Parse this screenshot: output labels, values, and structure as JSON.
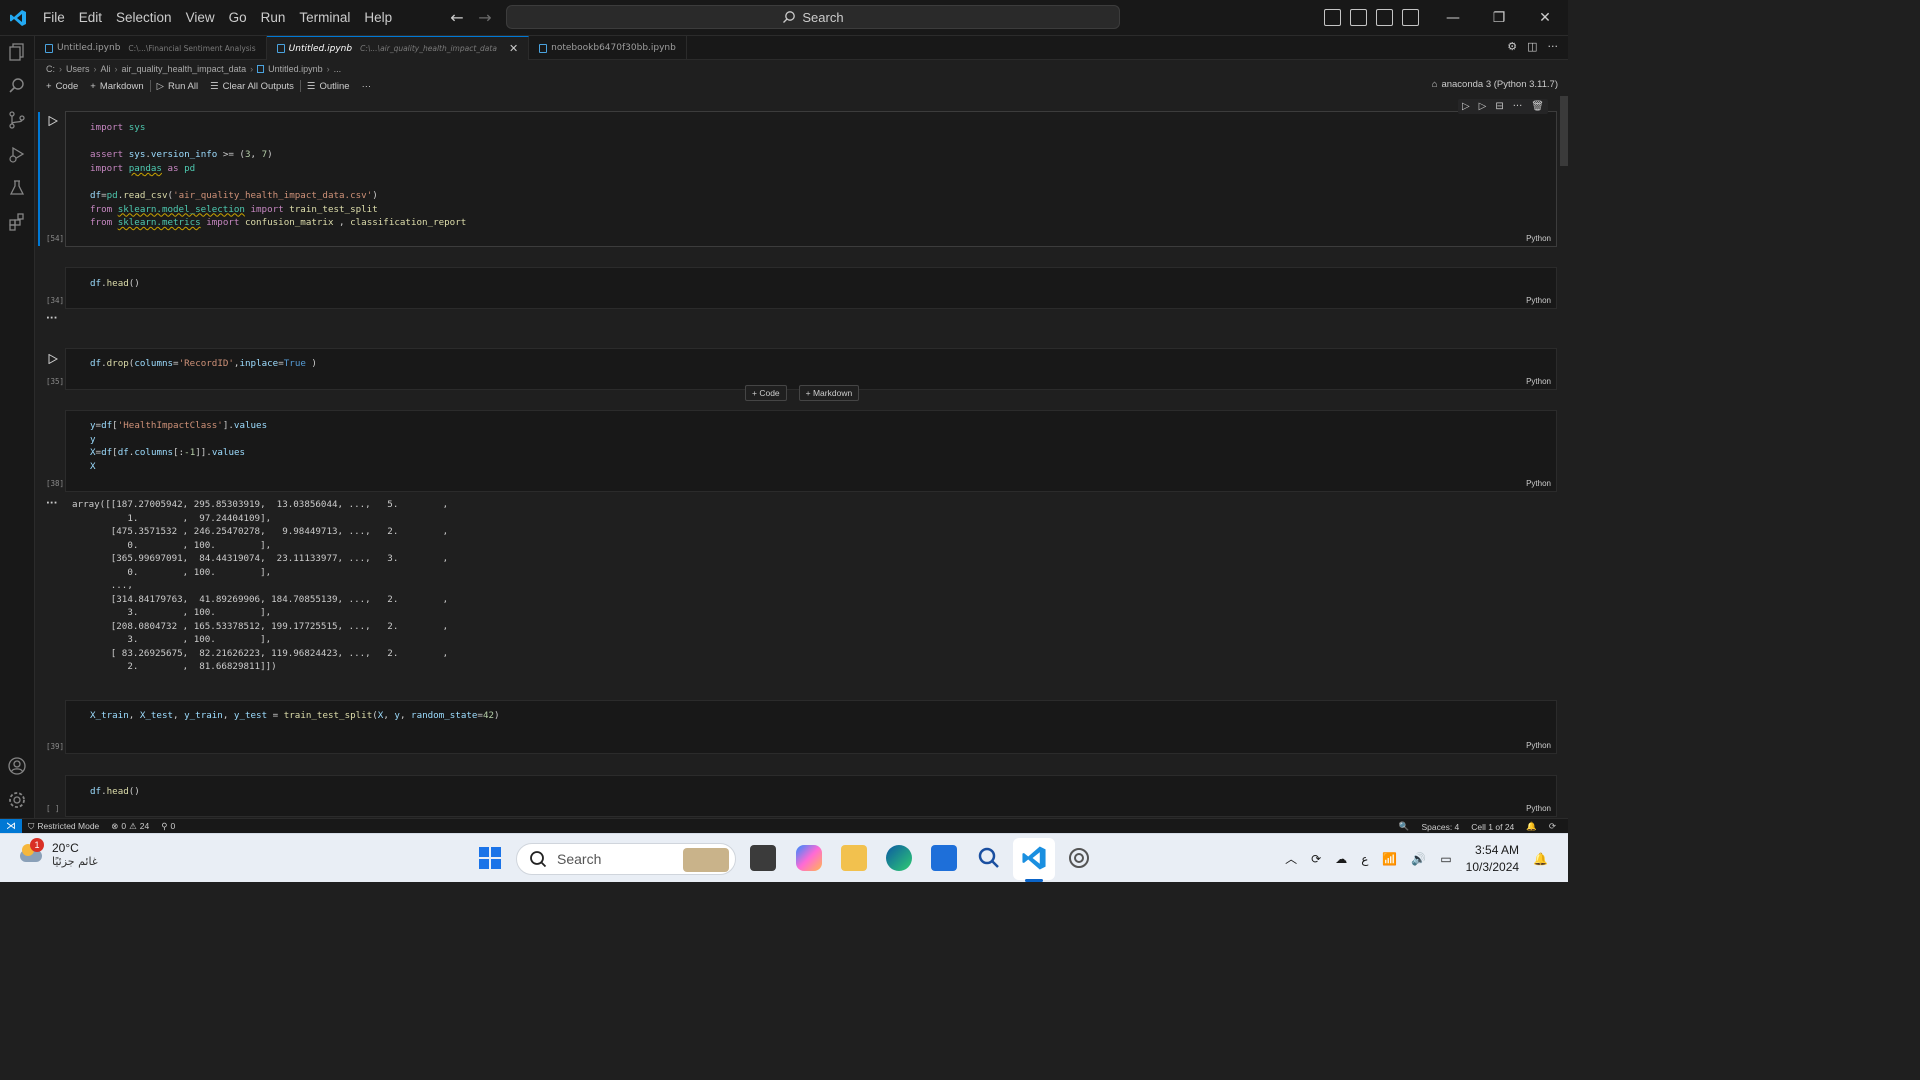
{
  "menu": [
    "File",
    "Edit",
    "Selection",
    "View",
    "Go",
    "Run",
    "Terminal",
    "Help"
  ],
  "search": {
    "label": "Search"
  },
  "tabs": [
    {
      "name": "Untitled.ipynb",
      "path": "C:\\...\\Financial Sentiment Analysis",
      "active": false
    },
    {
      "name": "Untitled.ipynb",
      "path": "C:\\...\\air_quality_health_impact_data",
      "active": true
    },
    {
      "name": "notebookb6470f30bb.ipynb",
      "path": "",
      "active": false
    }
  ],
  "breadcrumb": [
    "C:",
    "Users",
    "Ali",
    "air_quality_health_impact_data",
    "Untitled.ipynb",
    "..."
  ],
  "toolbar": {
    "code": "Code",
    "markdown": "Markdown",
    "run_all": "Run All",
    "clear_outputs": "Clear All Outputs",
    "outline": "Outline",
    "more": "···"
  },
  "kernel": "anaconda 3 (Python 3.11.7)",
  "cells": [
    {
      "exec": "[54]",
      "lang": "Python"
    },
    {
      "exec": "[34]",
      "lang": "Python"
    },
    {
      "exec": "[35]",
      "lang": "Python"
    },
    {
      "exec": "[38]",
      "lang": "Python"
    },
    {
      "exec": "[39]",
      "lang": "Python"
    },
    {
      "exec": "[ ]",
      "lang": "Python"
    }
  ],
  "cell_code": {
    "c1_l1": "import sys",
    "c1_l3": "assert sys.version_info >= (3, 7)",
    "c1_l4": "import pandas as pd",
    "c1_l6": "df=pd.read_csv('air_quality_health_impact_data.csv')",
    "c1_l7": "from sklearn.model_selection import train_test_split",
    "c1_l8": "from sklearn.metrics import confusion_matrix , classification_report",
    "c2": "df.head()",
    "c3": "df.drop(columns='RecordID',inplace=True )",
    "c4_l1": "y=df['HealthImpactClass'].values",
    "c4_l2": "y",
    "c4_l3": "X=df[df.columns[:-1]].values",
    "c4_l4": "X",
    "c5": "X_train, X_test, y_train, y_test = train_test_split(X, y, random_state=42)",
    "c6": "df.head()"
  },
  "output_dots": "···",
  "array_output": "array([[187.27005942, 295.85303919,  13.03856044, ...,   5.        ,\n          1.        ,  97.24404109],\n       [475.3571532 , 246.25470278,   9.98449713, ...,   2.        ,\n          0.        , 100.        ],\n       [365.99697091,  84.44319074,  23.11133977, ...,   3.        ,\n          0.        , 100.        ],\n       ...,\n       [314.84179763,  41.89269906, 184.70855139, ...,   2.        ,\n          3.        , 100.        ],\n       [208.0804732 , 165.53378512, 199.17725515, ...,   2.        ,\n          3.        , 100.        ],\n       [ 83.26925675,  82.21626223, 119.96824423, ...,   2.        ,\n          2.        ,  81.66829811]])",
  "insert": {
    "code": "+ Code",
    "markdown": "+ Markdown"
  },
  "status": {
    "restricted": "Restricted Mode",
    "errors": "0",
    "warnings": "24",
    "ports": "0",
    "spaces": "Spaces: 4",
    "cell": "Cell 1 of 24"
  },
  "taskbar": {
    "temp": "20°C",
    "condition": "غائم جزئيًا",
    "weather_badge": "1",
    "search": "Search",
    "lang": "ع",
    "time": "3:54 AM",
    "date": "10/3/2024"
  },
  "colors": {
    "accent": "#0078d4",
    "keyword": "#c586c0",
    "string": "#ce9178",
    "function": "#dcdcaa",
    "variable": "#9cdcfe",
    "number": "#b5cea8"
  }
}
